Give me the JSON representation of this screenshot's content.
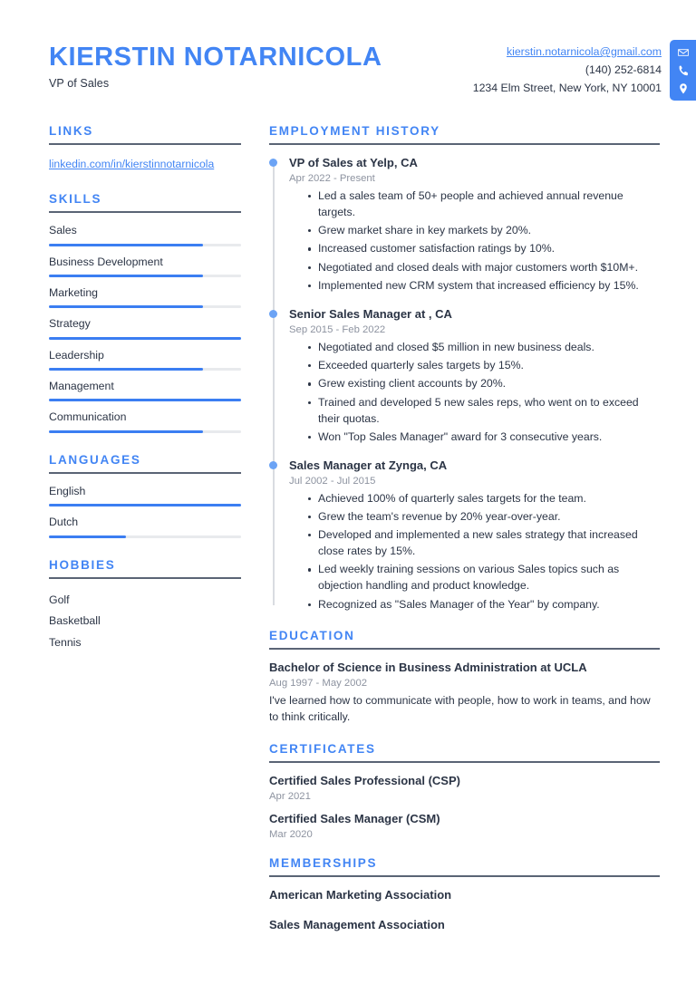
{
  "header": {
    "full_name": "KIERSTIN NOTARNICOLA",
    "job_title": "VP of Sales",
    "contact": {
      "email": "kierstin.notarnicola@gmail.com",
      "phone": "(140) 252-6814",
      "address": "1234 Elm Street, New York, NY 10001",
      "icons": [
        "envelope-icon",
        "phone-icon",
        "location-pin-icon"
      ]
    }
  },
  "theme": {
    "accent_blue": "#4285f4",
    "bar_blue": "#3b7ef2",
    "bar_track_gray": "#e8eaed",
    "rule_gray": "#5a6475",
    "text_dark": "#2b3445",
    "text_muted": "#8d93a0"
  },
  "sidebar": {
    "links": {
      "title": "LINKS",
      "items": [
        {
          "label": "linkedin.com/in/kierstinnotarnicola"
        }
      ]
    },
    "skills": {
      "title": "SKILLS",
      "items": [
        {
          "name": "Sales",
          "level": 80
        },
        {
          "name": "Business Development",
          "level": 80
        },
        {
          "name": "Marketing",
          "level": 80
        },
        {
          "name": "Strategy",
          "level": 100
        },
        {
          "name": "Leadership",
          "level": 80
        },
        {
          "name": "Management",
          "level": 100
        },
        {
          "name": "Communication",
          "level": 80
        }
      ]
    },
    "languages": {
      "title": "LANGUAGES",
      "items": [
        {
          "name": "English",
          "level": 100
        },
        {
          "name": "Dutch",
          "level": 40
        }
      ]
    },
    "hobbies": {
      "title": "HOBBIES",
      "items": [
        {
          "label": "Golf"
        },
        {
          "label": "Basketball"
        },
        {
          "label": "Tennis"
        }
      ]
    }
  },
  "main": {
    "employment": {
      "title": "EMPLOYMENT HISTORY",
      "jobs": [
        {
          "title": "VP of Sales at Yelp, CA",
          "date": "Apr 2022 - Present",
          "bullets": [
            "Led a sales team of 50+ people and achieved annual revenue targets.",
            "Grew market share in key markets by 20%.",
            "Increased customer satisfaction ratings by 10%.",
            "Negotiated and closed deals with major customers worth $10M+.",
            "Implemented new CRM system that increased efficiency by 15%."
          ]
        },
        {
          "title": "Senior Sales Manager at , CA",
          "date": "Sep 2015 - Feb 2022",
          "bullets": [
            "Negotiated and closed $5 million in new business deals.",
            "Exceeded quarterly sales targets by 15%.",
            "Grew existing client accounts by 20%.",
            "Trained and developed 5 new sales reps, who went on to exceed their quotas.",
            "Won \"Top Sales Manager\" award for 3 consecutive years."
          ]
        },
        {
          "title": "Sales Manager at Zynga, CA",
          "date": "Jul 2002 - Jul 2015",
          "bullets": [
            "Achieved 100% of quarterly sales targets for the team.",
            "Grew the team's revenue by 20% year-over-year.",
            "Developed and implemented a new sales strategy that increased close rates by 15%.",
            "Led weekly training sessions on various Sales topics such as objection handling and product knowledge.",
            "Recognized as \"Sales Manager of the Year\" by company."
          ]
        }
      ]
    },
    "education": {
      "title": "EDUCATION",
      "items": [
        {
          "title": "Bachelor of Science in Business Administration at UCLA",
          "date": "Aug 1997 - May 2002",
          "description": "I've learned how to communicate with people, how to work in teams, and how to think critically."
        }
      ]
    },
    "certificates": {
      "title": "CERTIFICATES",
      "items": [
        {
          "title": "Certified Sales Professional (CSP)",
          "date": "Apr 2021"
        },
        {
          "title": "Certified Sales Manager (CSM)",
          "date": "Mar 2020"
        }
      ]
    },
    "memberships": {
      "title": "MEMBERSHIPS",
      "items": [
        {
          "title": "American Marketing Association"
        },
        {
          "title": "Sales Management Association"
        }
      ]
    }
  }
}
